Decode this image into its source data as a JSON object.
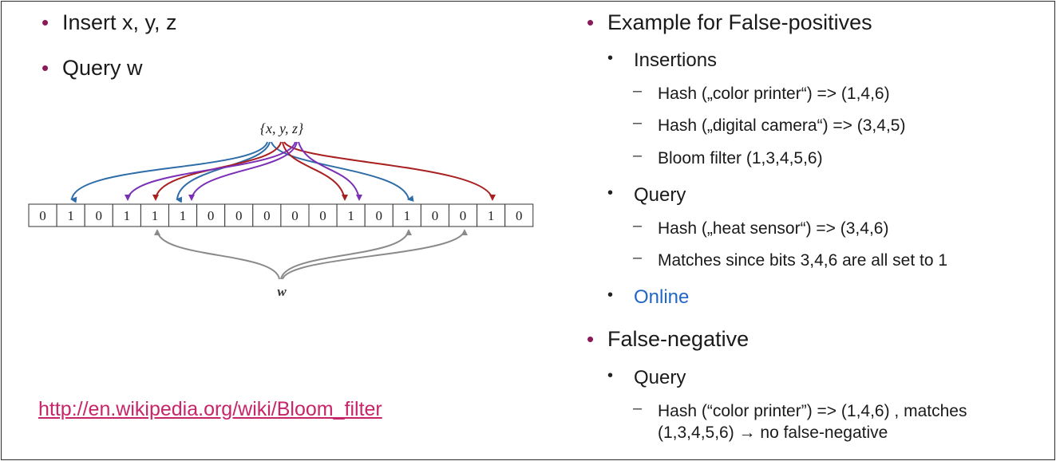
{
  "left": {
    "bullets": [
      "Insert x, y, z",
      "Query w"
    ],
    "link": "http://en.wikipedia.org/wiki/Bloom_filter"
  },
  "diagram": {
    "set_label": "{x, y, z}",
    "query_label": "w",
    "bits": [
      "0",
      "1",
      "0",
      "1",
      "1",
      "1",
      "0",
      "0",
      "0",
      "0",
      "0",
      "1",
      "0",
      "1",
      "0",
      "0",
      "1",
      "0"
    ]
  },
  "right": {
    "example_title": "Example for False-positives",
    "insertions_label": "Insertions",
    "insertions": [
      "Hash („color printer“) => (1,4,6)",
      "Hash („digital camera“) => (3,4,5)",
      "Bloom filter (1,3,4,5,6)"
    ],
    "query_label": "Query",
    "query_items": [
      "Hash („heat sensor“) => (3,4,6)",
      "Matches since bits 3,4,6 are all set to 1"
    ],
    "online_label": "Online",
    "false_negative_title": "False-negative",
    "fn_query_label": "Query",
    "fn_items": [
      "Hash (“color printer”) => (1,4,6) , matches",
      "(1,3,4,5,6) → no false-negative"
    ]
  },
  "colors": {
    "bullet": "#8b1a5a",
    "link": "#c7256a",
    "online": "#1f66c7",
    "arrow_blue": "#2e6ca8",
    "arrow_red": "#a8201f",
    "arrow_purple": "#7a2fb5",
    "arrow_gray": "#8a8a8a"
  }
}
